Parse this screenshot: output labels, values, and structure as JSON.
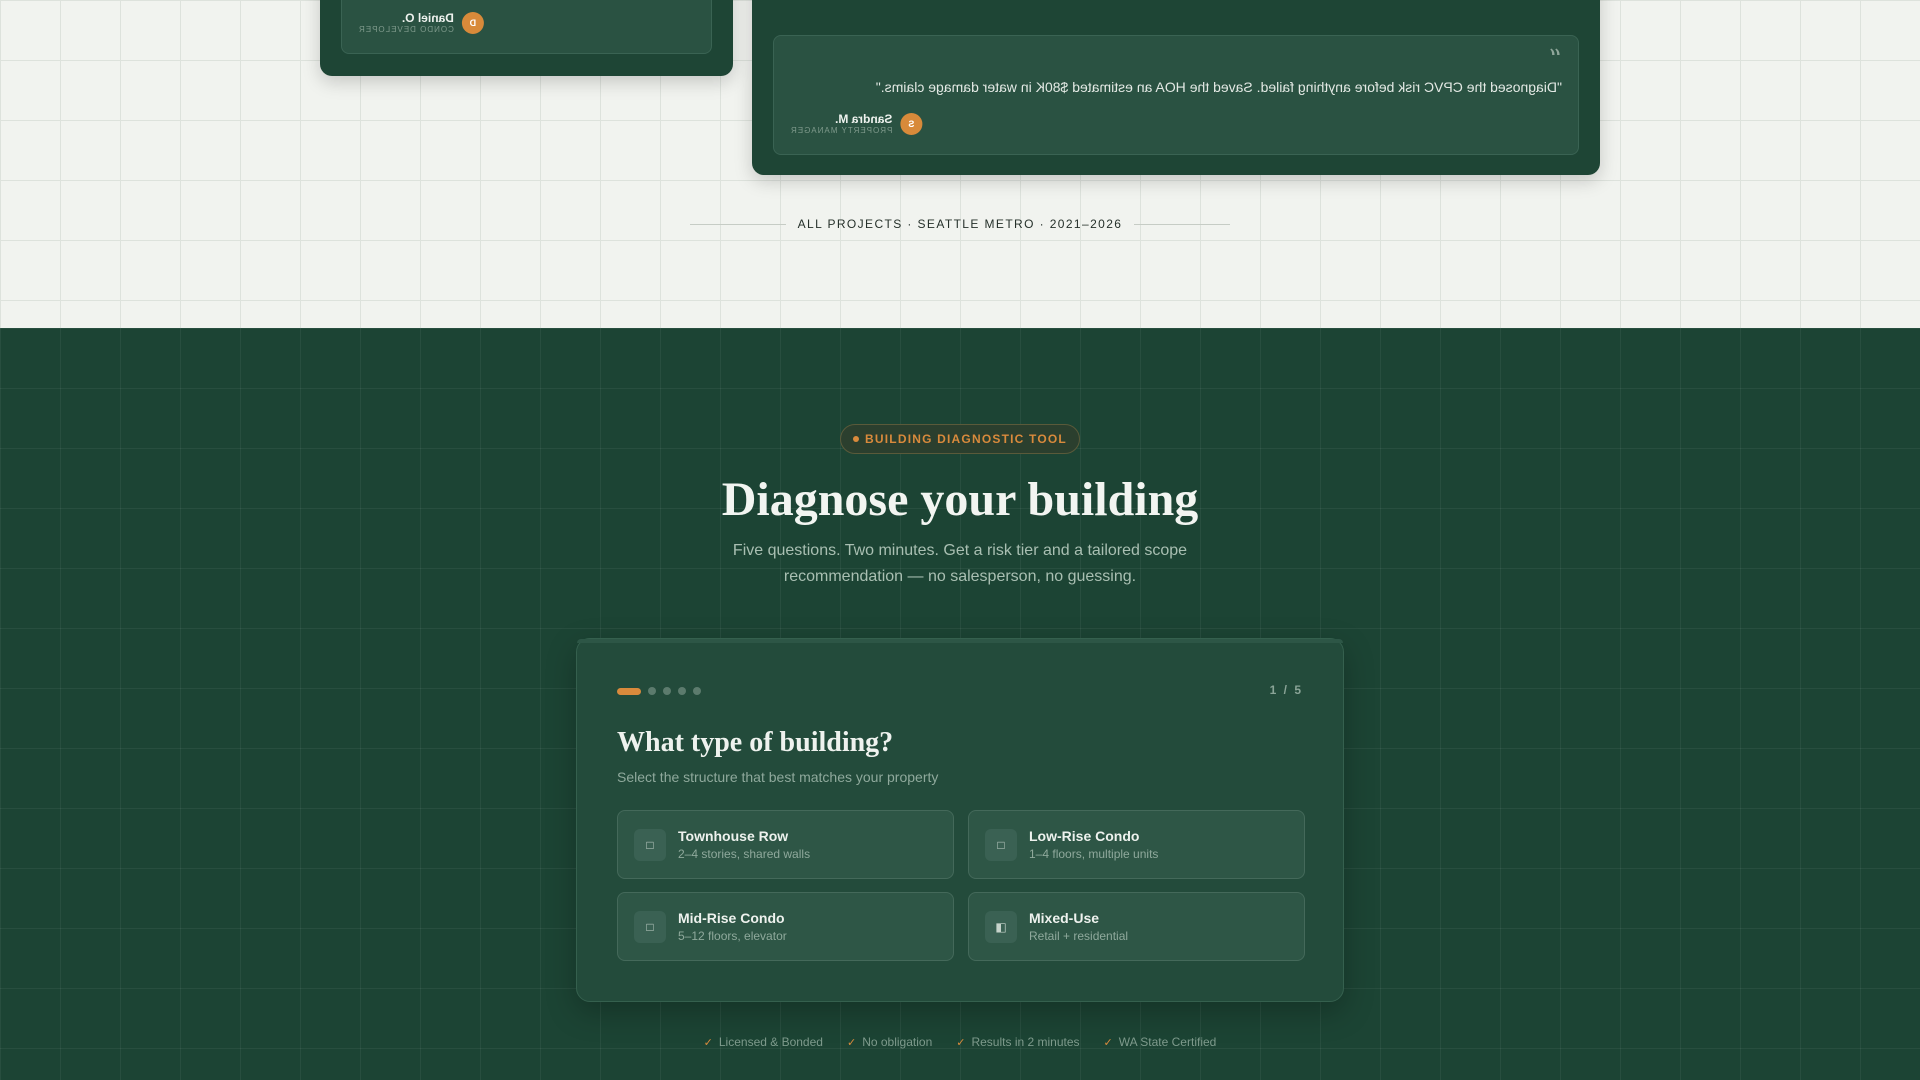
{
  "testimonials": [
    {
      "quote": "",
      "author": "Daniel O.",
      "role": "CONDO DEVELOPER",
      "initial": "D"
    },
    {
      "quote": "\"Diagnosed the CPVC risk before anything failed. Saved the HOA an estimated $80K in water damage claims.\"",
      "author": "Sandra M.",
      "role": "PROPERTY MANAGER",
      "initial": "S"
    }
  ],
  "projects_divider": "ALL PROJECTS · SEATTLE METRO · 2021–2026",
  "tool": {
    "badge": "BUILDING DIAGNOSTIC TOOL",
    "title": "Diagnose your building",
    "subtitle": "Five questions. Two minutes. Get a risk tier and a tailored scope recommendation — no salesperson, no guessing.",
    "step_label": "1 / 5",
    "question": "What type of building?",
    "question_hint": "Select the structure that best matches your property",
    "options": [
      {
        "title": "Townhouse Row",
        "subtitle": "2–4 stories, shared walls",
        "icon": "townhouse-icon"
      },
      {
        "title": "Low-Rise Condo",
        "subtitle": "1–4 floors, multiple units",
        "icon": "lowrise-icon"
      },
      {
        "title": "Mid-Rise Condo",
        "subtitle": "5–12 floors, elevator",
        "icon": "midrise-icon"
      },
      {
        "title": "Mixed-Use",
        "subtitle": "Retail + residential",
        "icon": "mixed-use-icon"
      }
    ],
    "progress": {
      "current": 1,
      "total": 5
    }
  },
  "trust_badges": [
    "Licensed & Bonded",
    "No obligation",
    "Results in 2 minutes",
    "WA State Certified"
  ],
  "colors": {
    "brand_dark": "#1c4434",
    "accent": "#d98a3c",
    "light_bg": "#f1f3ef"
  }
}
